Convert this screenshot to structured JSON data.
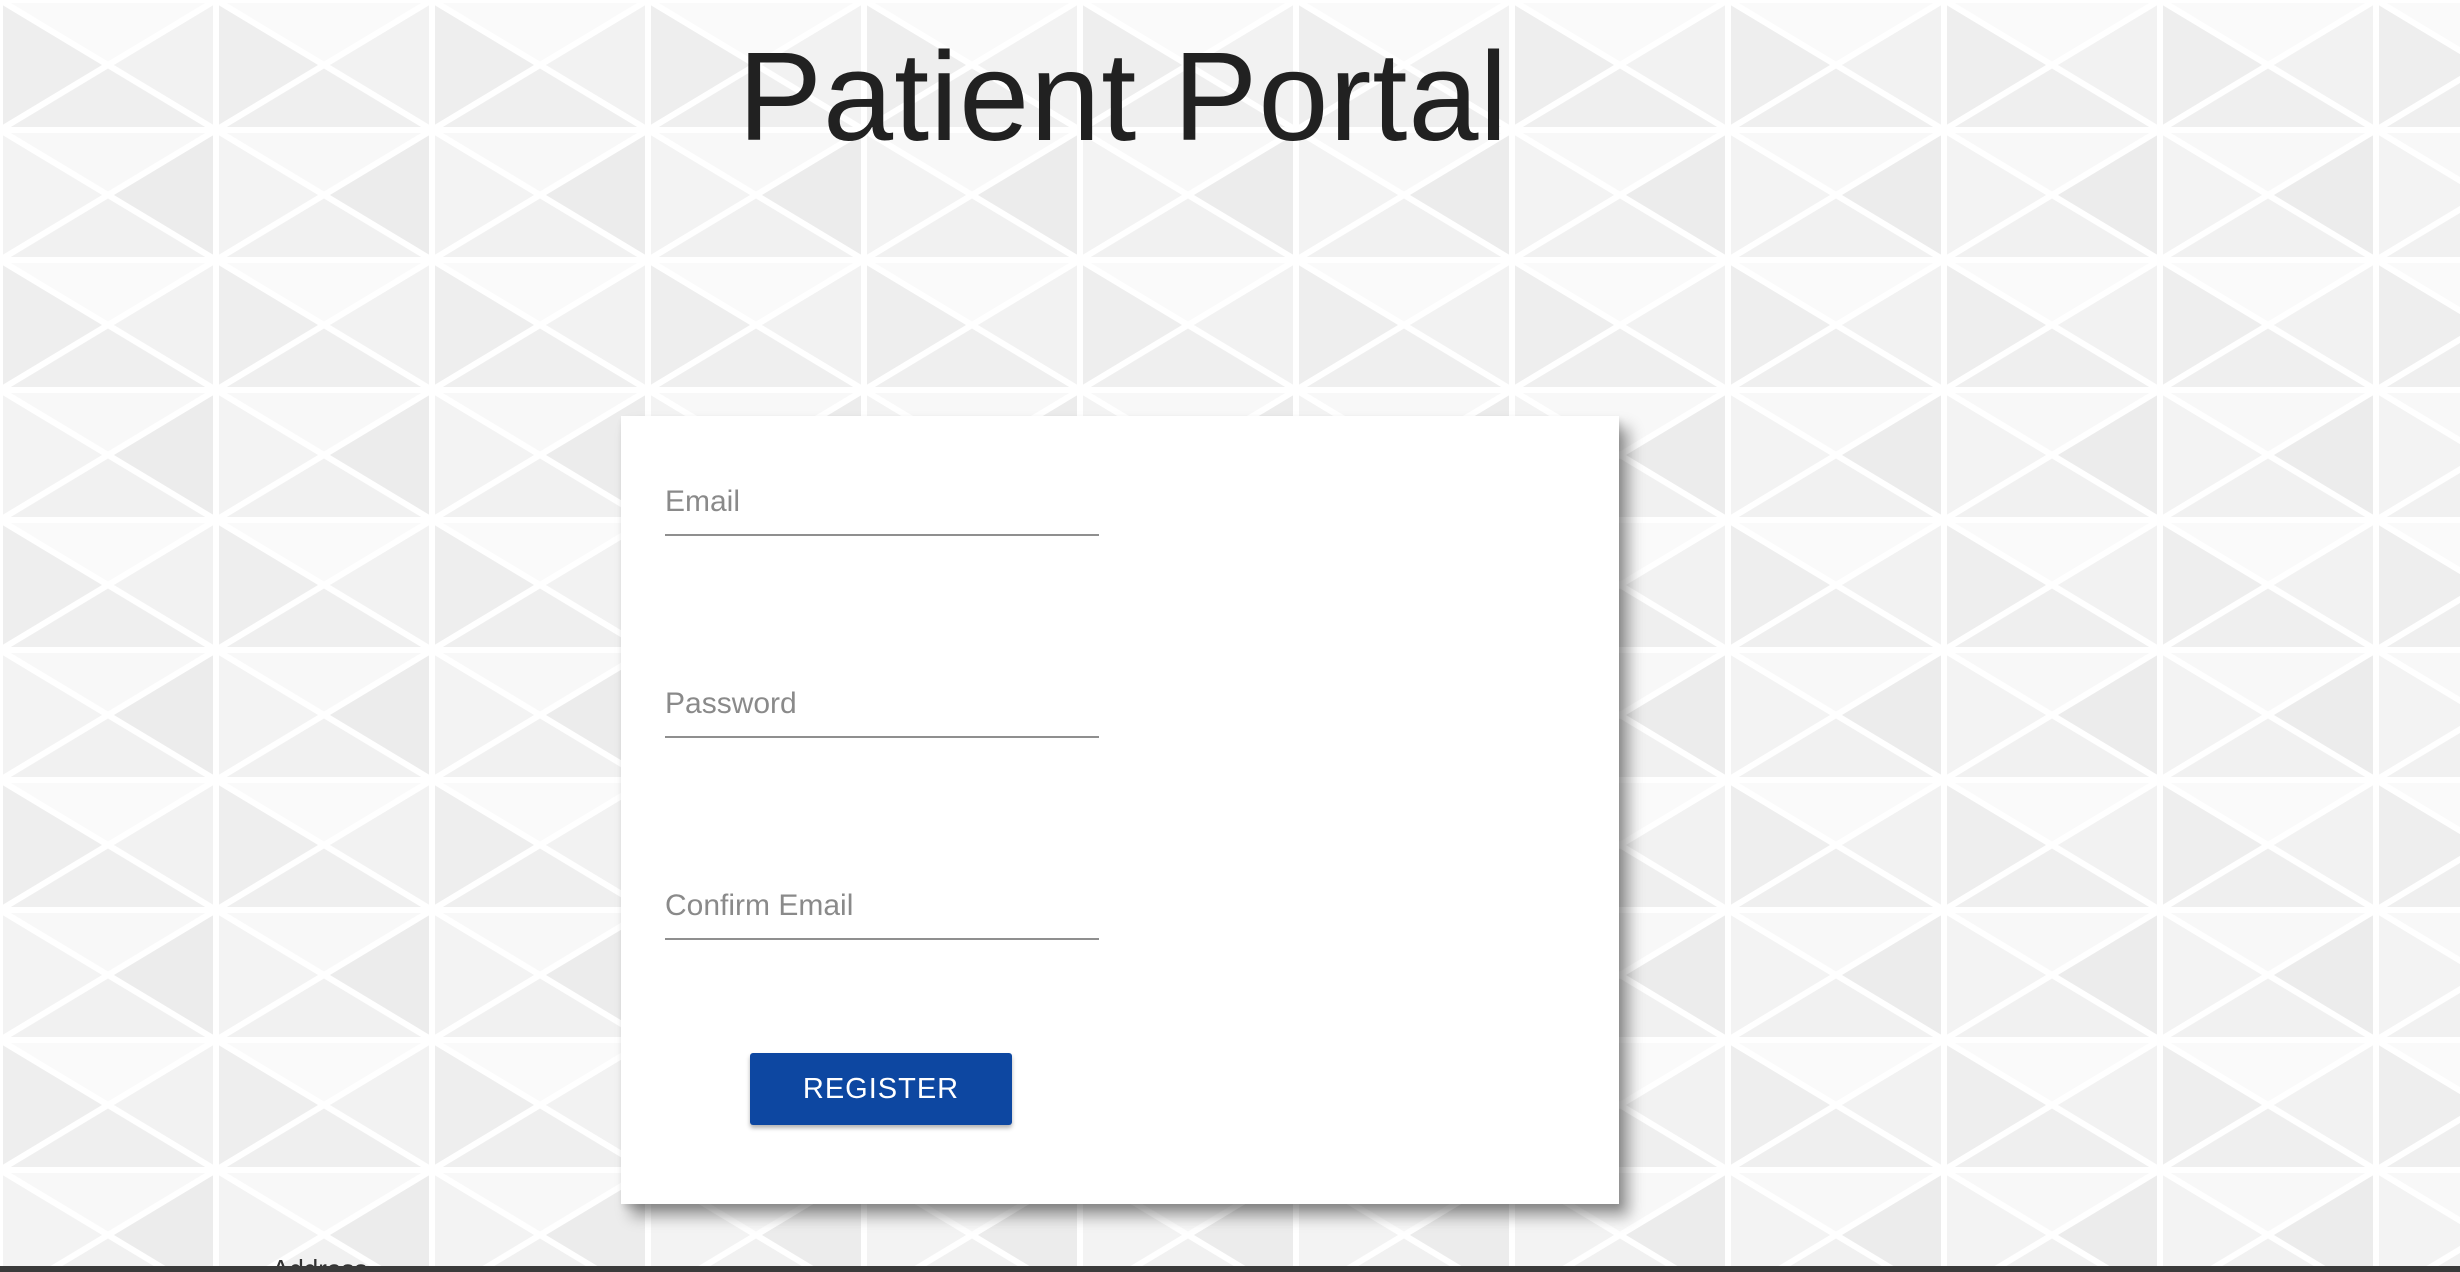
{
  "page": {
    "title": "Patient Portal"
  },
  "form": {
    "email": {
      "placeholder": "Email",
      "value": ""
    },
    "password": {
      "placeholder": "Password",
      "value": ""
    },
    "confirm_email": {
      "placeholder": "Confirm Email",
      "value": ""
    },
    "register_label": "REGISTER"
  },
  "footer": {
    "fragment": "Address"
  },
  "colors": {
    "accent": "#0d47a1",
    "title_text": "#212121",
    "placeholder_text": "#8a8a8a",
    "card_background": "#ffffff",
    "page_background": "#f7f7f7"
  }
}
